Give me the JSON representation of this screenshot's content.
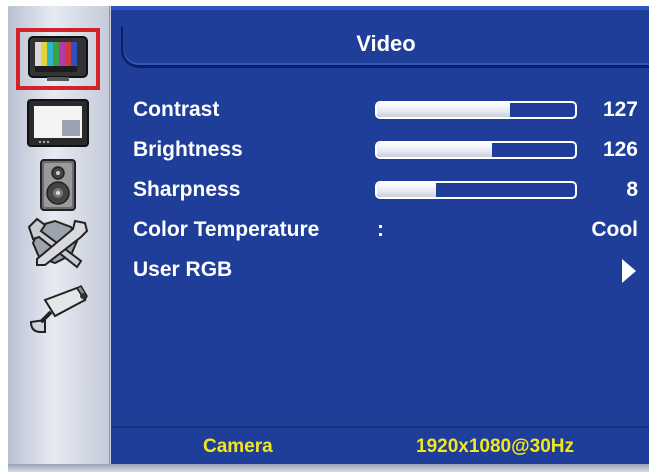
{
  "menu": {
    "title": "Video",
    "items": [
      {
        "label": "Contrast",
        "type": "slider",
        "value": "127",
        "level": 0.67
      },
      {
        "label": "Brightness",
        "type": "slider",
        "value": "126",
        "level": 0.58
      },
      {
        "label": "Sharpness",
        "type": "slider",
        "value": "8",
        "level": 0.3
      },
      {
        "label": "Color Temperature",
        "type": "option",
        "separator": ":",
        "value": "Cool"
      },
      {
        "label": "User RGB",
        "type": "submenu"
      }
    ]
  },
  "sidebar": {
    "items": [
      {
        "icon": "video-test-pattern-icon",
        "selected": true
      },
      {
        "icon": "display-monitor-icon",
        "selected": false
      },
      {
        "icon": "speaker-icon",
        "selected": false
      },
      {
        "icon": "tools-icon",
        "selected": false
      },
      {
        "icon": "security-camera-icon",
        "selected": false
      }
    ]
  },
  "status": {
    "source": "Camera",
    "resolution": "1920x1080@30Hz"
  },
  "colors": {
    "panel": "#1f3e9a",
    "selection_border": "#d2232a",
    "status_text": "#f2e61c"
  }
}
